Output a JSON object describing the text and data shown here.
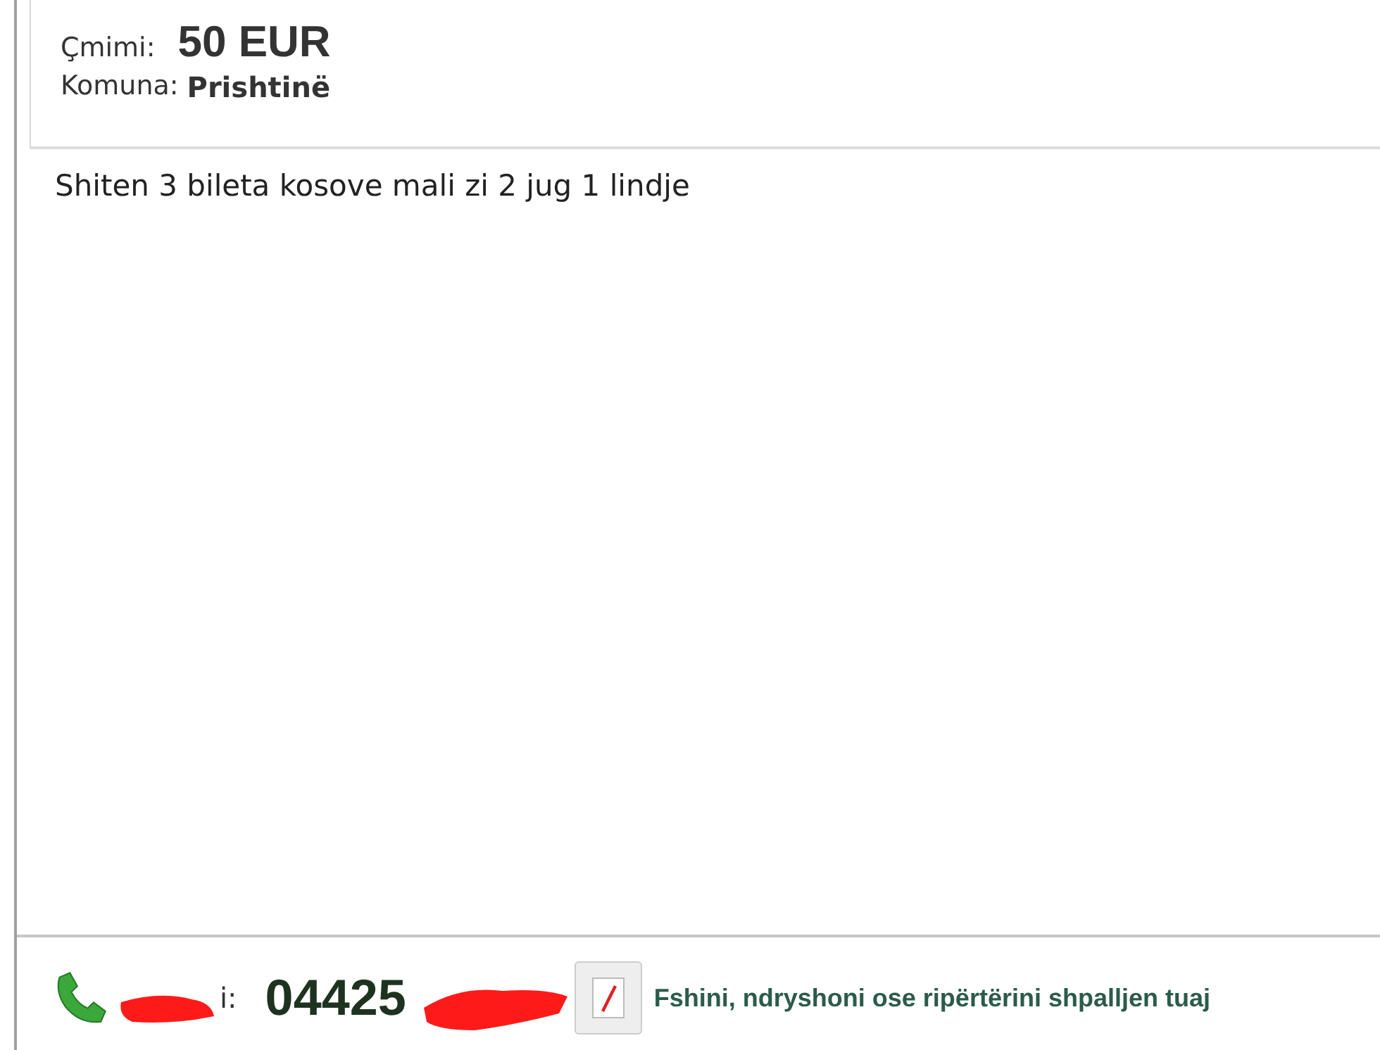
{
  "details": {
    "price_label": "Çmimi:",
    "price": "50 EUR",
    "municipality_label": "Komuna:",
    "municipality": "Prishtinë"
  },
  "description": "Shiten 3 bileta kosove mali zi 2 jug 1 lindje",
  "contact": {
    "phone_label": "i:",
    "phone": "04425",
    "edit_link": "Fshini, ndryshoni ose ripërtërini shpalljen tuaj"
  }
}
